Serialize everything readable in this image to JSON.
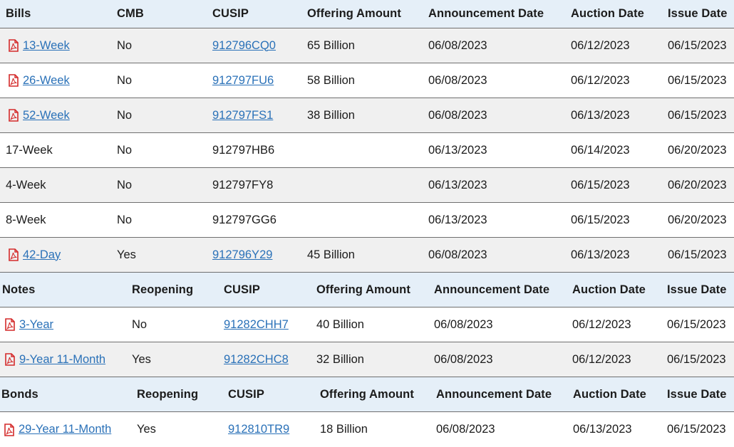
{
  "bills": {
    "headers": [
      "Bills",
      "CMB",
      "CUSIP",
      "Offering Amount",
      "Announcement Date",
      "Auction Date",
      "Issue Date"
    ],
    "rows": [
      {
        "term": "13-Week",
        "link": true,
        "flag": "No",
        "cusip": "912796CQ0",
        "amount": "65 Billion",
        "announce": "06/08/2023",
        "auction": "06/12/2023",
        "issue": "06/15/2023"
      },
      {
        "term": "26-Week",
        "link": true,
        "flag": "No",
        "cusip": "912797FU6",
        "amount": "58 Billion",
        "announce": "06/08/2023",
        "auction": "06/12/2023",
        "issue": "06/15/2023"
      },
      {
        "term": "52-Week",
        "link": true,
        "flag": "No",
        "cusip": "912797FS1",
        "amount": "38 Billion",
        "announce": "06/08/2023",
        "auction": "06/13/2023",
        "issue": "06/15/2023"
      },
      {
        "term": "17-Week",
        "link": false,
        "flag": "No",
        "cusip": "912797HB6",
        "amount": "",
        "announce": "06/13/2023",
        "auction": "06/14/2023",
        "issue": "06/20/2023"
      },
      {
        "term": "4-Week",
        "link": false,
        "flag": "No",
        "cusip": "912797FY8",
        "amount": "",
        "announce": "06/13/2023",
        "auction": "06/15/2023",
        "issue": "06/20/2023"
      },
      {
        "term": "8-Week",
        "link": false,
        "flag": "No",
        "cusip": "912797GG6",
        "amount": "",
        "announce": "06/13/2023",
        "auction": "06/15/2023",
        "issue": "06/20/2023"
      },
      {
        "term": "42-Day",
        "link": true,
        "flag": "Yes",
        "cusip": "912796Y29",
        "amount": "45 Billion",
        "announce": "06/08/2023",
        "auction": "06/13/2023",
        "issue": "06/15/2023"
      }
    ]
  },
  "notes": {
    "headers": [
      "Notes",
      "Reopening",
      "CUSIP",
      "Offering Amount",
      "Announcement Date",
      "Auction Date",
      "Issue Date"
    ],
    "rows": [
      {
        "term": "3-Year",
        "link": true,
        "flag": "No",
        "cusip": "91282CHH7",
        "amount": "40 Billion",
        "announce": "06/08/2023",
        "auction": "06/12/2023",
        "issue": "06/15/2023"
      },
      {
        "term": "9-Year 11-Month",
        "link": true,
        "flag": "Yes",
        "cusip": "91282CHC8",
        "amount": "32 Billion",
        "announce": "06/08/2023",
        "auction": "06/12/2023",
        "issue": "06/15/2023"
      }
    ]
  },
  "bonds": {
    "headers": [
      "Bonds",
      "Reopening",
      "CUSIP",
      "Offering Amount",
      "Announcement Date",
      "Auction Date",
      "Issue Date"
    ],
    "rows": [
      {
        "term": "29-Year 11-Month",
        "link": true,
        "flag": "Yes",
        "cusip": "912810TR9",
        "amount": "18 Billion",
        "announce": "06/08/2023",
        "auction": "06/13/2023",
        "issue": "06/15/2023"
      }
    ]
  },
  "colors": {
    "link": "#2a71b8",
    "pdf_icon": "#d42a2a",
    "header_bg": "#e5eff8",
    "stripe_bg": "#f0f0f0"
  },
  "icons": {
    "pdf": "pdf-icon"
  }
}
